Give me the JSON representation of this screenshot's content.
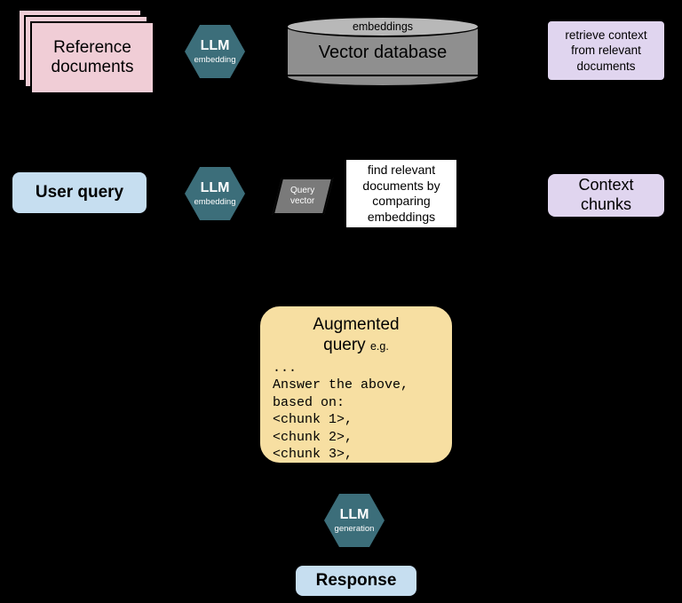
{
  "ref_docs_label": "Reference\ndocuments",
  "llm_embed_row1": {
    "big": "LLM",
    "small": "embedding"
  },
  "vector_db": {
    "top": "embeddings",
    "label": "Vector database"
  },
  "retrieve_box": "retrieve context\nfrom relevant\ndocuments",
  "user_query": "User query",
  "llm_embed_row2": {
    "big": "LLM",
    "small": "embedding"
  },
  "query_vector": "Query\nvector",
  "find_relevant": "find relevant\ndocuments by\ncomparing\nembeddings",
  "context_chunks": "Context\nchunks",
  "augmented": {
    "title_main": "Augmented",
    "title_sub": "query",
    "eg": "e.g.",
    "code": "...\nAnswer the above,\nbased on:\n<chunk 1>,\n<chunk 2>,\n<chunk 3>,"
  },
  "llm_gen": {
    "big": "LLM",
    "small": "generation"
  },
  "response": "Response"
}
